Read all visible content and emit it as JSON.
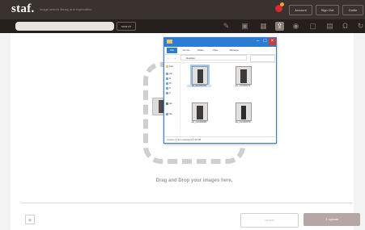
{
  "header": {
    "logo": "staf.",
    "tagline": "image search library and exploration",
    "buttons": [
      "Account",
      "Sign Out",
      "Guide"
    ]
  },
  "toolbar": {
    "search_placeholder": "",
    "search_label": "search"
  },
  "explorer": {
    "tabs": [
      "File",
      "Home",
      "Share",
      "View",
      "Manage"
    ],
    "path": "Desktop",
    "nav_items": [
      "Fav",
      "Lib",
      "D",
      "M",
      "P",
      "V",
      "Ho",
      "Ne"
    ],
    "files": [
      {
        "name": "afs_EH0460004"
      },
      {
        "name": "afs_CH0460070"
      },
      {
        "name": "afs_CH0460082"
      },
      {
        "name": "afs_CH0460079"
      }
    ],
    "status": "4 items   1 item selected  3.44 KB",
    "drag_tip": "+ Move"
  },
  "drop": {
    "text": "Drag and Drop your images here."
  },
  "footer": {
    "add_label": "+",
    "cancel_label": "cancel",
    "upload_label": "upload"
  },
  "colors": {
    "topbar": "#3a322e",
    "accent": "#2c7cd3",
    "upload": "#b7a6a6"
  }
}
